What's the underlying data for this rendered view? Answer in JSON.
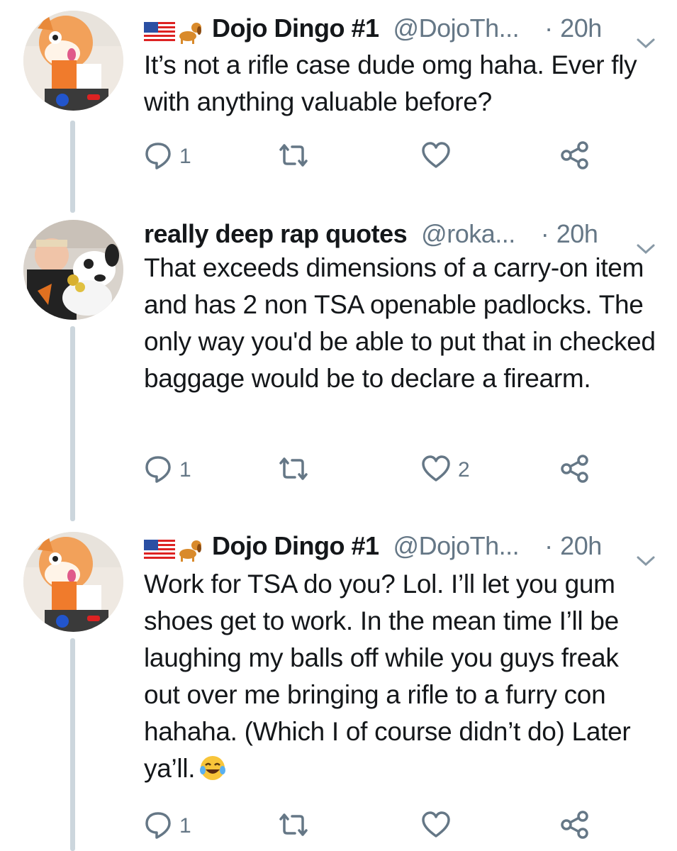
{
  "tweets": [
    {
      "name": "Dojo Dingo #1",
      "handle": "@DojoTh...",
      "dot": "·",
      "time": "20h",
      "text": "It’s not a rifle case dude omg haha.  Ever fly with anything valuable before?",
      "replies": "1",
      "retweets": "",
      "likes": "",
      "flags": [
        "us-flag-icon",
        "dog-emoji-icon"
      ]
    },
    {
      "name": "really deep rap quotes",
      "handle": "@roka...",
      "dot": "·",
      "time": "20h",
      "text": "That exceeds dimensions of a carry-on item and has 2 non TSA openable padlocks. The only way you'd be able to put that in checked baggage would be to declare a firearm.",
      "replies": "1",
      "retweets": "",
      "likes": "2"
    },
    {
      "name": "Dojo Dingo #1",
      "handle": "@DojoTh...",
      "dot": "·",
      "time": "20h",
      "text": "Work for TSA do you? Lol. I’ll let you gum shoes get to work. In the mean time I’ll be laughing my balls off while you guys freak out over me bringing a rifle to a furry con hahaha. (Which I of course didn’t do) Later ya’ll.",
      "replies": "1",
      "retweets": "",
      "likes": "",
      "trailing_emoji": "laughing-tears-emoji",
      "flags": [
        "us-flag-icon",
        "dog-emoji-icon"
      ]
    }
  ],
  "colors": {
    "text": "#14171a",
    "muted": "#657786",
    "thread_line": "#ccd6dd",
    "background": "#ffffff"
  }
}
